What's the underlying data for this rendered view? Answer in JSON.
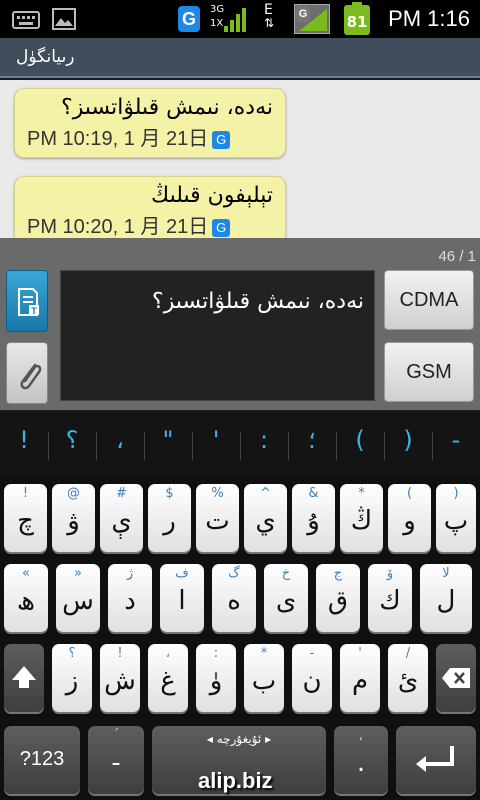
{
  "status": {
    "time": "PM 1:16",
    "battery": "81",
    "net3g": "3G",
    "net1x": "1X",
    "netE": "E",
    "g_label": "G"
  },
  "header": {
    "contact": "رىيانگۈل"
  },
  "messages": [
    {
      "text": "نەدە، نىمش قىلۋاتسىز؟",
      "meta": "PM 10:19, 1 月 21日"
    },
    {
      "text": "تېلېفون  قىلىڭ",
      "meta": "PM 10:20, 1 月 21日"
    }
  ],
  "compose": {
    "counter": "46 / 1",
    "text": "نەدە، نىمش قىلۋاتسىز؟",
    "cdma": "CDMA",
    "gsm": "GSM"
  },
  "symbols": [
    "!",
    "؟",
    "،",
    "\"",
    "'",
    ":",
    "؛",
    "(",
    ")",
    "-"
  ],
  "keyboard": {
    "row1": [
      {
        "m": "چ",
        "s": "!"
      },
      {
        "m": "ۋ",
        "s": "@"
      },
      {
        "m": "ې",
        "s": "#"
      },
      {
        "m": "ر",
        "s": "$"
      },
      {
        "m": "ت",
        "s": "%"
      },
      {
        "m": "ي",
        "s": "^"
      },
      {
        "m": "ۇ",
        "s": "&"
      },
      {
        "m": "ڭ",
        "s": "*"
      },
      {
        "m": "و",
        "s": "("
      },
      {
        "m": "پ",
        "s": ")"
      }
    ],
    "row2": [
      {
        "m": "ھ",
        "s": "«"
      },
      {
        "m": "س",
        "s": "»"
      },
      {
        "m": "د",
        "s": "ژ"
      },
      {
        "m": "ا",
        "s": "ف"
      },
      {
        "m": "ە",
        "s": "گ"
      },
      {
        "m": "ى",
        "s": "خ"
      },
      {
        "m": "ق",
        "s": "ج"
      },
      {
        "m": "ك",
        "s": "ۆ"
      },
      {
        "m": "ل",
        "s": "لا"
      }
    ],
    "row3": [
      {
        "m": "ز",
        "s": "؟"
      },
      {
        "m": "ش",
        "s": "!"
      },
      {
        "m": "غ",
        "s": "،"
      },
      {
        "m": "ۈ",
        "s": ":"
      },
      {
        "m": "ب",
        "s": "*"
      },
      {
        "m": "ن",
        "s": "-"
      },
      {
        "m": "م",
        "s": "'"
      },
      {
        "m": "ئ",
        "s": "/"
      }
    ],
    "row4": {
      "k123": "?123",
      "dash": "-",
      "dash_sub": "´",
      "space": "◂ ئۇيغۇرچە ▸",
      "dot": ".",
      "dot_sub": ","
    }
  },
  "watermark": "alip.biz",
  "colors": {
    "accent": "#38b6e6",
    "bubble": "#f4f2a6",
    "title": "#3f4d5c",
    "badge": "#1e88e5"
  }
}
